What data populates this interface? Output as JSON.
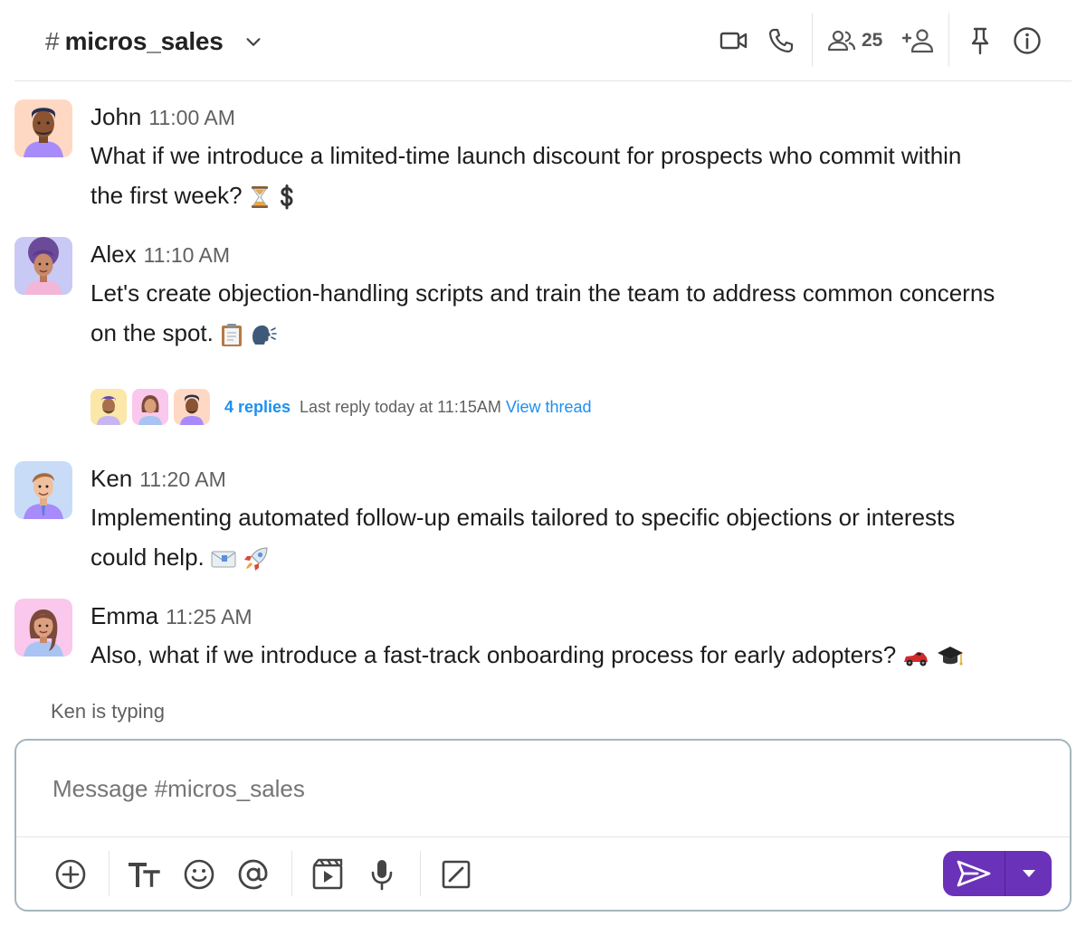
{
  "header": {
    "hash": "#",
    "channel_name": "micros_sales",
    "member_count": "25",
    "icons": [
      "chevron-down-icon",
      "video-camera-icon",
      "phone-icon",
      "members-icon",
      "add-person-icon",
      "pin-icon",
      "info-icon"
    ]
  },
  "messages": [
    {
      "author": "John",
      "time": "11:00 AM",
      "text_line1": "What if we introduce a limited-time launch discount for prospects who commit within",
      "text_line2": "the first week?",
      "emoji": [
        "hourglass",
        "dollar-sign"
      ]
    },
    {
      "author": "Alex",
      "time": "11:10 AM",
      "text_line1": "Let's create objection-handling scripts and train the team to address common concerns",
      "text_line2": "on the spot.",
      "emoji": [
        "clipboard",
        "speaking-head"
      ]
    },
    {
      "author": "Ken",
      "time": "11:20 AM",
      "text_line1": "Implementing automated follow-up emails tailored to specific objections or interests",
      "text_line2": "could help.",
      "emoji": [
        "envelope",
        "rocket"
      ]
    },
    {
      "author": "Emma",
      "time": "11:25 AM",
      "text_line1": "Also, what if we introduce a fast-track onboarding process for early adopters?",
      "emoji": [
        "race-car",
        "graduation-cap"
      ]
    }
  ],
  "thread": {
    "replies": "4 replies",
    "last_reply": "Last reply today at 11:15AM",
    "view_thread": "View thread"
  },
  "typing_indicator": "Ken is typing",
  "composer": {
    "placeholder": "Message #micros_sales",
    "toolbar_icons": [
      "add-circle-icon",
      "text-format-icon",
      "emoji-icon",
      "mention-icon",
      "video-clip-icon",
      "microphone-icon",
      "slash-command-icon"
    ],
    "send_icon": "send-icon",
    "send_options_icon": "caret-down-icon"
  },
  "colors": {
    "accent": "#6a32b8",
    "link": "#1d8ff0",
    "avatar_john": "#ffd8c4",
    "avatar_alex": "#c9c9f5",
    "avatar_ken": "#c8dcf8",
    "avatar_emma": "#f9c8ec"
  }
}
